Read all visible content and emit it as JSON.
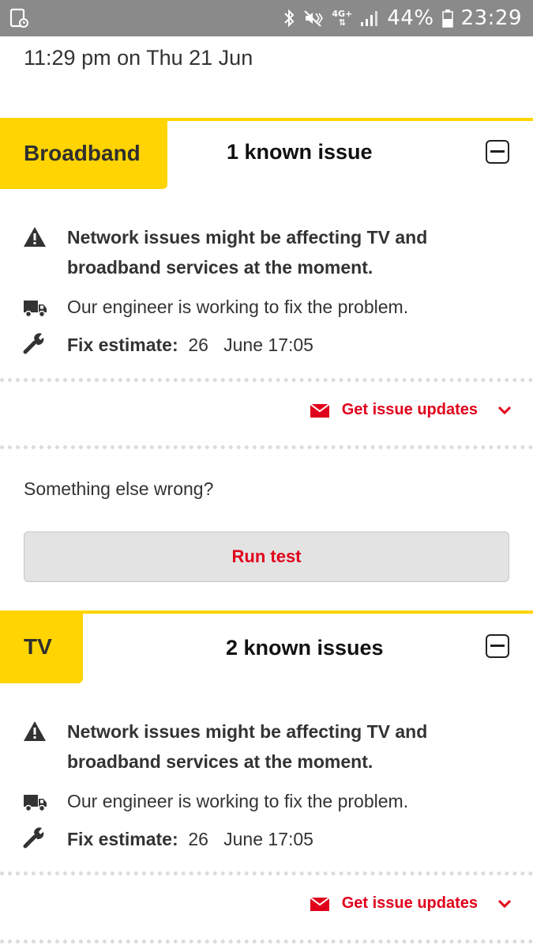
{
  "status_bar": {
    "network": "4G+",
    "battery": "44%",
    "time": "23:29"
  },
  "timestamp": "11:29 pm on Thu 21 Jun",
  "broadband": {
    "tag": "Broadband",
    "issues_title": "1 known issue",
    "alert_line1": "Network issues might be affecting TV and",
    "alert_line2": "broadband services at the moment.",
    "engineer": "Our engineer is working to fix the problem.",
    "fix_label": "Fix estimate:",
    "fix_value": "26   June 17:05",
    "updates_label": "Get issue updates"
  },
  "something_else": "Something else wrong?",
  "run_test_label": "Run test",
  "tv": {
    "tag": "TV",
    "issues_title": "2 known issues",
    "alert_line1": "Network issues might be affecting TV and",
    "alert_line2": "broadband services at the moment.",
    "engineer": "Our engineer is working to fix the problem.",
    "fix_label": "Fix estimate:",
    "fix_value": "26   June 17:05",
    "updates_label": "Get issue updates"
  },
  "colors": {
    "accent_yellow": "#ffd400",
    "action_red": "#e0001b",
    "status_bar": "#8a8a8a"
  },
  "icons": [
    "screenshot-icon",
    "bluetooth-icon",
    "mute-vibrate-icon",
    "signal-icon",
    "battery-icon",
    "collapse-icon",
    "warning-icon",
    "truck-icon",
    "wrench-icon",
    "mail-icon",
    "chevron-down-icon"
  ]
}
